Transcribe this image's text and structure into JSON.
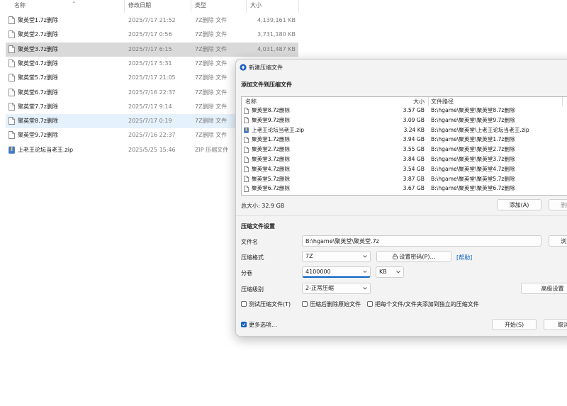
{
  "explorer": {
    "columns": {
      "name": "名称",
      "date": "修改日期",
      "type": "类型",
      "size": "大小"
    },
    "files": [
      {
        "name": "聚英堂1.7z删除",
        "date": "2025/7/17 21:52",
        "type": "7Z删除 文件",
        "size": "4,139,161 KB",
        "icon": "document-icon",
        "state": ""
      },
      {
        "name": "聚英堂2.7z删除",
        "date": "2025/7/17 0:56",
        "type": "7Z删除 文件",
        "size": "3,731,180 KB",
        "icon": "document-icon",
        "state": ""
      },
      {
        "name": "聚英堂3.7z删除",
        "date": "2025/7/17 6:15",
        "type": "7Z删除 文件",
        "size": "4,031,487 KB",
        "icon": "document-icon",
        "state": "selected"
      },
      {
        "name": "聚英堂4.7z删除",
        "date": "2025/7/17 5:31",
        "type": "7Z删除 文件",
        "size": "",
        "icon": "document-icon",
        "state": ""
      },
      {
        "name": "聚英堂5.7z删除",
        "date": "2025/7/17 21:05",
        "type": "7Z删除 文件",
        "size": "",
        "icon": "document-icon",
        "state": ""
      },
      {
        "name": "聚英堂6.7z删除",
        "date": "2025/7/16 22:37",
        "type": "7Z删除 文件",
        "size": "",
        "icon": "document-icon",
        "state": ""
      },
      {
        "name": "聚英堂7.7z删除",
        "date": "2025/7/17 9:14",
        "type": "7Z删除 文件",
        "size": "",
        "icon": "document-icon",
        "state": ""
      },
      {
        "name": "聚英堂8.7z删除",
        "date": "2025/7/17 0:19",
        "type": "7Z删除 文件",
        "size": "",
        "icon": "document-icon",
        "state": "hover"
      },
      {
        "name": "聚英堂9.7z删除",
        "date": "2025/7/16 22:37",
        "type": "7Z删除 文件",
        "size": "",
        "icon": "document-icon",
        "state": ""
      },
      {
        "name": "上老王论坛当老王.zip",
        "date": "2025/5/25 15:46",
        "type": "ZIP 压缩文件",
        "size": "",
        "icon": "zip-archive-icon",
        "state": ""
      }
    ]
  },
  "dialog": {
    "title": "新建压缩文件",
    "add_section_title": "添加文件到压缩文件",
    "list_columns": {
      "name": "名称",
      "size": "大小",
      "path": "文件路径"
    },
    "list_items": [
      {
        "name": "聚英堂8.7z删除",
        "size": "3.57 GB",
        "path": "B:\\hgame\\聚英堂\\聚英堂8.7z删除",
        "icon": "document-icon"
      },
      {
        "name": "聚英堂9.7z删除",
        "size": "3.09 GB",
        "path": "B:\\hgame\\聚英堂\\聚英堂9.7z删除",
        "icon": "document-icon"
      },
      {
        "name": "上老王论坛当老王.zip",
        "size": "3.24 KB",
        "path": "B:\\hgame\\聚英堂\\上老王论坛当老王.zip",
        "icon": "zip-archive-icon"
      },
      {
        "name": "聚英堂1.7z删除",
        "size": "3.94 GB",
        "path": "B:\\hgame\\聚英堂\\聚英堂1.7z删除",
        "icon": "document-icon"
      },
      {
        "name": "聚英堂2.7z删除",
        "size": "3.55 GB",
        "path": "B:\\hgame\\聚英堂\\聚英堂2.7z删除",
        "icon": "document-icon"
      },
      {
        "name": "聚英堂3.7z删除",
        "size": "3.84 GB",
        "path": "B:\\hgame\\聚英堂\\聚英堂3.7z删除",
        "icon": "document-icon"
      },
      {
        "name": "聚英堂4.7z删除",
        "size": "3.54 GB",
        "path": "B:\\hgame\\聚英堂\\聚英堂4.7z删除",
        "icon": "document-icon"
      },
      {
        "name": "聚英堂5.7z删除",
        "size": "3.87 GB",
        "path": "B:\\hgame\\聚英堂\\聚英堂5.7z删除",
        "icon": "document-icon"
      },
      {
        "name": "聚英堂6.7z删除",
        "size": "3.67 GB",
        "path": "B:\\hgame\\聚英堂\\聚英堂6.7z删除",
        "icon": "document-icon"
      }
    ],
    "total_size": "总大小: 32.9 GB",
    "add_button": "添加(A)",
    "remove_button": "删除",
    "settings_title": "压缩文件设置",
    "filename_label": "文件名",
    "filename_value": "B:\\hgame\\聚英堂\\聚英堂.7z",
    "browse_button": "浏览",
    "format_label": "压缩格式",
    "format_value": "7Z",
    "password_button": "设置密码(P)...",
    "help_link": "[帮助]",
    "split_label": "分卷",
    "split_value": "4100000",
    "split_unit": "KB",
    "level_label": "压缩级别",
    "level_value": "2-正常压缩",
    "advanced_button": "高级设置",
    "test_checkbox": "测试压缩文件(T)",
    "delete_checkbox": "压缩后删除原始文件",
    "separate_checkbox": "把每个文件/文件夹添加到独立的压缩文件",
    "more_options": "更多选项...",
    "start_button": "开始(S)",
    "cancel_button": "取消",
    "colors": {
      "accent": "#0a62c2",
      "selected_row": "#d9d9d9",
      "hover_row": "#e5f1fb"
    }
  }
}
